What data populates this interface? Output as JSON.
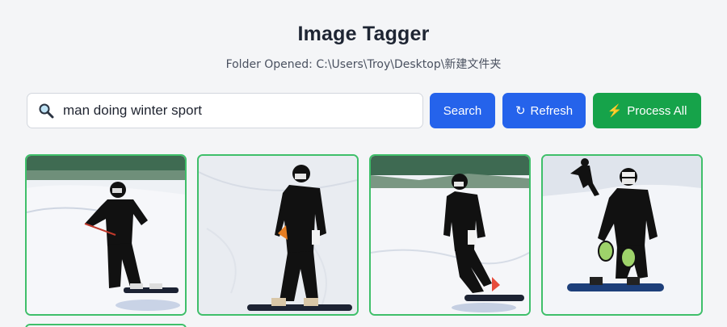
{
  "app": {
    "title": "Image Tagger",
    "folder_text": "Folder Opened: C:\\Users\\Troy\\Desktop\\新建文件夹"
  },
  "search": {
    "value": "man doing winter sport",
    "icon": "magnifier-icon"
  },
  "buttons": {
    "search_label": "Search",
    "refresh_label": "Refresh",
    "refresh_icon": "↻",
    "process_label": "Process All",
    "process_icon": "⚡"
  },
  "colors": {
    "primary": "#2563eb",
    "success": "#16a34a",
    "card_border": "#3fbf6a"
  },
  "gallery": {
    "images": [
      {
        "subject": "snowboarder-image-1"
      },
      {
        "subject": "snowboarder-image-2"
      },
      {
        "subject": "snowboarder-image-3"
      },
      {
        "subject": "snowboarder-image-4"
      }
    ]
  }
}
